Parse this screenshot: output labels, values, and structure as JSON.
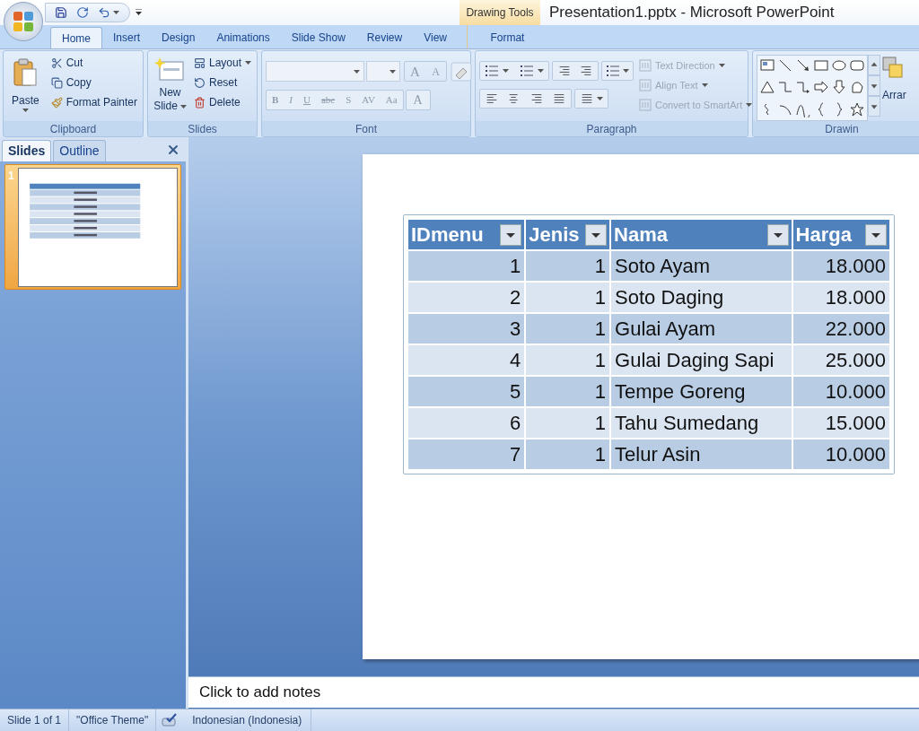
{
  "window": {
    "title": "Presentation1.pptx - Microsoft PowerPoint"
  },
  "contextual_tab": {
    "label": "Drawing Tools",
    "tabs": [
      {
        "label": "Format",
        "selected": false
      }
    ]
  },
  "ribbon_tabs": [
    {
      "label": "Home",
      "selected": true
    },
    {
      "label": "Insert",
      "selected": false
    },
    {
      "label": "Design",
      "selected": false
    },
    {
      "label": "Animations",
      "selected": false
    },
    {
      "label": "Slide Show",
      "selected": false
    },
    {
      "label": "Review",
      "selected": false
    },
    {
      "label": "View",
      "selected": false
    }
  ],
  "clipboard": {
    "label": "Clipboard",
    "paste": "Paste",
    "items": [
      "Cut",
      "Copy",
      "Format Painter"
    ]
  },
  "slides_group": {
    "label": "Slides",
    "new_slide": [
      "New",
      "Slide"
    ],
    "items": [
      "Layout",
      "Reset",
      "Delete"
    ]
  },
  "font": {
    "label": "Font",
    "disabled": true,
    "size_buttons": [
      "A",
      "A"
    ],
    "format_buttons": [
      "B",
      "I",
      "U",
      "abc",
      "S",
      "AV",
      "Aa"
    ],
    "color_button": "A"
  },
  "paragraph": {
    "label": "Paragraph",
    "items": [
      {
        "label": "Text Direction",
        "disabled": true
      },
      {
        "label": "Align Text",
        "disabled": true
      },
      {
        "label": "Convert to SmartArt",
        "disabled": true
      }
    ]
  },
  "drawing": {
    "label": "Drawin",
    "arrange": "Arrar"
  },
  "pane": {
    "tabs": [
      {
        "label": "Slides",
        "selected": true
      },
      {
        "label": "Outline",
        "selected": false
      }
    ],
    "thumbnails": [
      {
        "number": "1",
        "selected": true
      }
    ]
  },
  "table": {
    "columns": [
      {
        "label": "IDmenu",
        "kind": "number"
      },
      {
        "label": "Jenis",
        "kind": "number"
      },
      {
        "label": "Nama",
        "kind": "text"
      },
      {
        "label": "Harga",
        "kind": "number"
      }
    ],
    "rows": [
      [
        "1",
        "1",
        "Soto Ayam",
        "18.000"
      ],
      [
        "2",
        "1",
        "Soto Daging",
        "18.000"
      ],
      [
        "3",
        "1",
        "Gulai Ayam",
        "22.000"
      ],
      [
        "4",
        "1",
        "Gulai Daging Sapi",
        "25.000"
      ],
      [
        "5",
        "1",
        "Tempe Goreng",
        "10.000"
      ],
      [
        "6",
        "1",
        "Tahu Sumedang",
        "15.000"
      ],
      [
        "7",
        "1",
        "Telur Asin",
        "10.000"
      ]
    ]
  },
  "notes": {
    "placeholder": "Click to add notes"
  },
  "status_bar": {
    "items": [
      "Slide 1 of 1",
      "\"Office Theme\""
    ],
    "language": "Indonesian (Indonesia)"
  }
}
